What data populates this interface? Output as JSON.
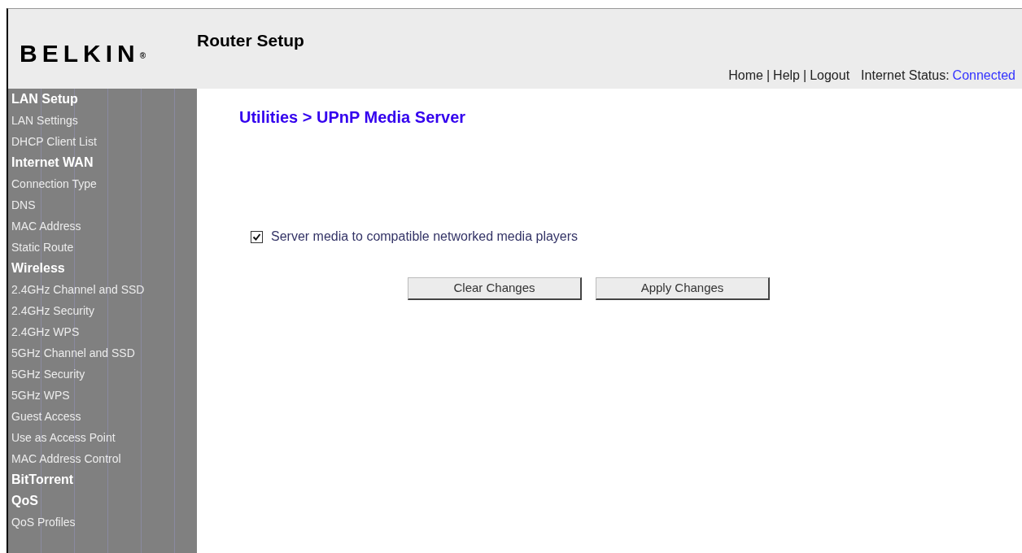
{
  "header": {
    "logo": "BELKIN",
    "logo_mark": "®",
    "title": "Router Setup",
    "links": [
      "Home",
      "Help",
      "Logout"
    ],
    "link_separator": "|",
    "status_label": "Internet Status:",
    "status_value": "Connected"
  },
  "sidebar": {
    "items": [
      {
        "kind": "header",
        "label": "LAN Setup"
      },
      {
        "kind": "item",
        "label": "LAN Settings"
      },
      {
        "kind": "item",
        "label": "DHCP Client List"
      },
      {
        "kind": "header",
        "label": "Internet WAN"
      },
      {
        "kind": "item",
        "label": "Connection Type"
      },
      {
        "kind": "item",
        "label": "DNS"
      },
      {
        "kind": "item",
        "label": "MAC Address"
      },
      {
        "kind": "item",
        "label": "Static Route"
      },
      {
        "kind": "header",
        "label": "Wireless"
      },
      {
        "kind": "item",
        "label": "2.4GHz Channel and SSD"
      },
      {
        "kind": "item",
        "label": "2.4GHz Security"
      },
      {
        "kind": "item",
        "label": "2.4GHz WPS"
      },
      {
        "kind": "item",
        "label": "5GHz Channel and SSD"
      },
      {
        "kind": "item",
        "label": "5GHz Security"
      },
      {
        "kind": "item",
        "label": "5GHz WPS"
      },
      {
        "kind": "item",
        "label": "Guest Access"
      },
      {
        "kind": "item",
        "label": "Use as Access Point"
      },
      {
        "kind": "item",
        "label": "MAC Address Control"
      },
      {
        "kind": "header",
        "label": "BitTorrent"
      },
      {
        "kind": "header",
        "label": "QoS"
      },
      {
        "kind": "item",
        "label": "QoS Profiles"
      }
    ]
  },
  "main": {
    "heading": "Utilities > UPnP Media Server",
    "option": {
      "label": "Server media to compatible networked media players",
      "checked": true
    },
    "buttons": [
      "Clear Changes",
      "Apply Changes"
    ]
  }
}
